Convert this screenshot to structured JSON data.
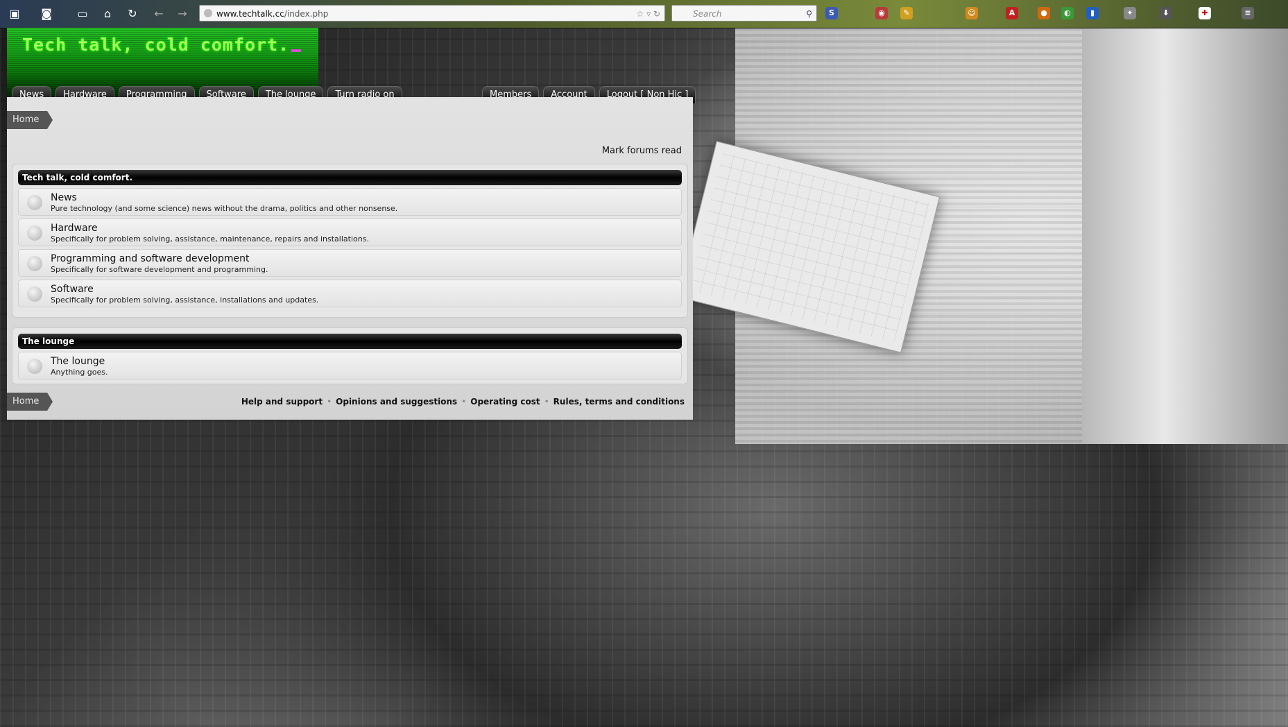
{
  "browser": {
    "url_host": "www.techtalk.cc",
    "url_path": "/index.php",
    "search_placeholder": "Search"
  },
  "site": {
    "logo_text": "Tech talk, cold comfort."
  },
  "nav": {
    "left": [
      "News",
      "Hardware",
      "Programming",
      "Software",
      "The lounge",
      "Turn radio on"
    ],
    "right": [
      "Members",
      "Account",
      "Logout [ Non Hic ]"
    ]
  },
  "breadcrumb": {
    "home": "Home"
  },
  "mark_read": "Mark forums read",
  "categories": [
    {
      "title": "Tech talk, cold comfort.",
      "forums": [
        {
          "title": "News",
          "desc": "Pure technology (and some science) news without the drama, politics and other nonsense."
        },
        {
          "title": "Hardware",
          "desc": "Specifically for problem solving, assistance, maintenance, repairs and installations."
        },
        {
          "title": "Programming and software development",
          "desc": "Specifically for software development and programming."
        },
        {
          "title": "Software",
          "desc": "Specifically for problem solving, assistance, installations and updates."
        }
      ]
    },
    {
      "title": "The lounge",
      "forums": [
        {
          "title": "The lounge",
          "desc": "Anything goes."
        }
      ]
    }
  ],
  "footer": {
    "links": [
      "Help and support",
      "Opinions and suggestions",
      "Operating cost",
      "Rules, terms and conditions"
    ]
  },
  "colors": {
    "logo_green": "#a6ff5a",
    "header_green": "#1aa61a",
    "nav_bg": "#0b0b0b",
    "cursor_magenta": "#d64bd6"
  }
}
